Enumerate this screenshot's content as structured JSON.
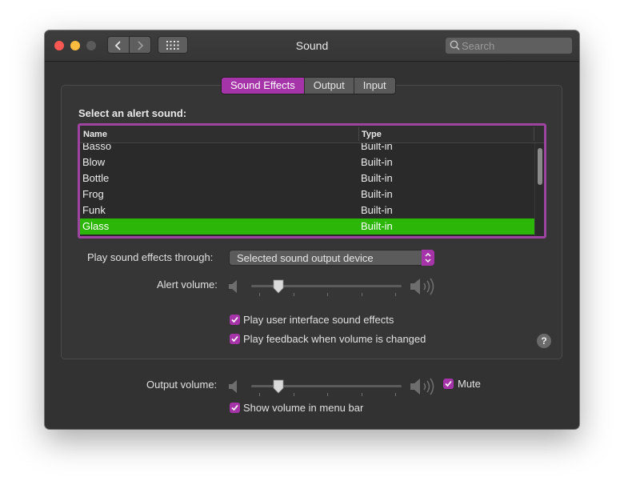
{
  "window": {
    "title": "Sound",
    "search_placeholder": "Search"
  },
  "tabs": [
    {
      "label": "Sound Effects",
      "active": true
    },
    {
      "label": "Output",
      "active": false
    },
    {
      "label": "Input",
      "active": false
    }
  ],
  "sound_effects": {
    "section_label": "Select an alert sound:",
    "columns": {
      "name": "Name",
      "type": "Type"
    },
    "rows": [
      {
        "name": "Basso",
        "type": "Built-in"
      },
      {
        "name": "Blow",
        "type": "Built-in"
      },
      {
        "name": "Bottle",
        "type": "Built-in"
      },
      {
        "name": "Frog",
        "type": "Built-in"
      },
      {
        "name": "Funk",
        "type": "Built-in"
      },
      {
        "name": "Glass",
        "type": "Built-in",
        "selected": true
      }
    ],
    "play_through_label": "Play sound effects through:",
    "play_through_value": "Selected sound output device",
    "alert_volume_label": "Alert volume:",
    "alert_volume_level": 0.18,
    "ui_sounds_label": "Play user interface sound effects",
    "ui_sounds_checked": true,
    "feedback_label": "Play feedback when volume is changed",
    "feedback_checked": true,
    "help_label": "?"
  },
  "output": {
    "volume_label": "Output volume:",
    "volume_level": 0.18,
    "mute_label": "Mute",
    "mute_checked": true,
    "menu_bar_label": "Show volume in menu bar",
    "menu_bar_checked": true
  },
  "colors": {
    "accent": "#a634a9",
    "selection": "#2cb708",
    "window_bg": "#323232"
  }
}
